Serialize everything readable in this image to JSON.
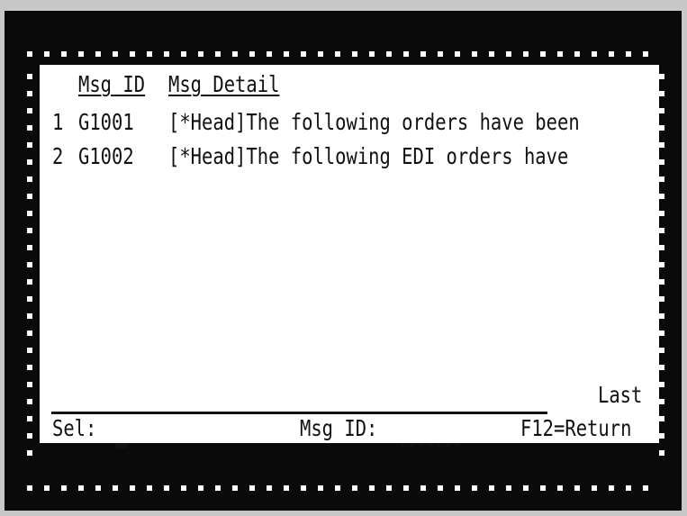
{
  "header": {
    "col_msg_id": "Msg ID",
    "col_msg_detail": "Msg Detail"
  },
  "rows": [
    {
      "num": "1",
      "msg_id": "G1001",
      "detail": "[*Head]The following orders have been"
    },
    {
      "num": "2",
      "msg_id": "G1002",
      "detail": "[*Head]The following EDI orders have"
    }
  ],
  "status": {
    "last": "Last"
  },
  "footer": {
    "sel_label": "Sel:",
    "sel_value": "",
    "msgid_label": "Msg ID:",
    "msgid_value": "",
    "f12": "F12=Return"
  },
  "colors": {
    "frame": "#0a0a0a",
    "screen": "#ffffff",
    "text": "#111111",
    "desktop": "#c8c8c8"
  }
}
